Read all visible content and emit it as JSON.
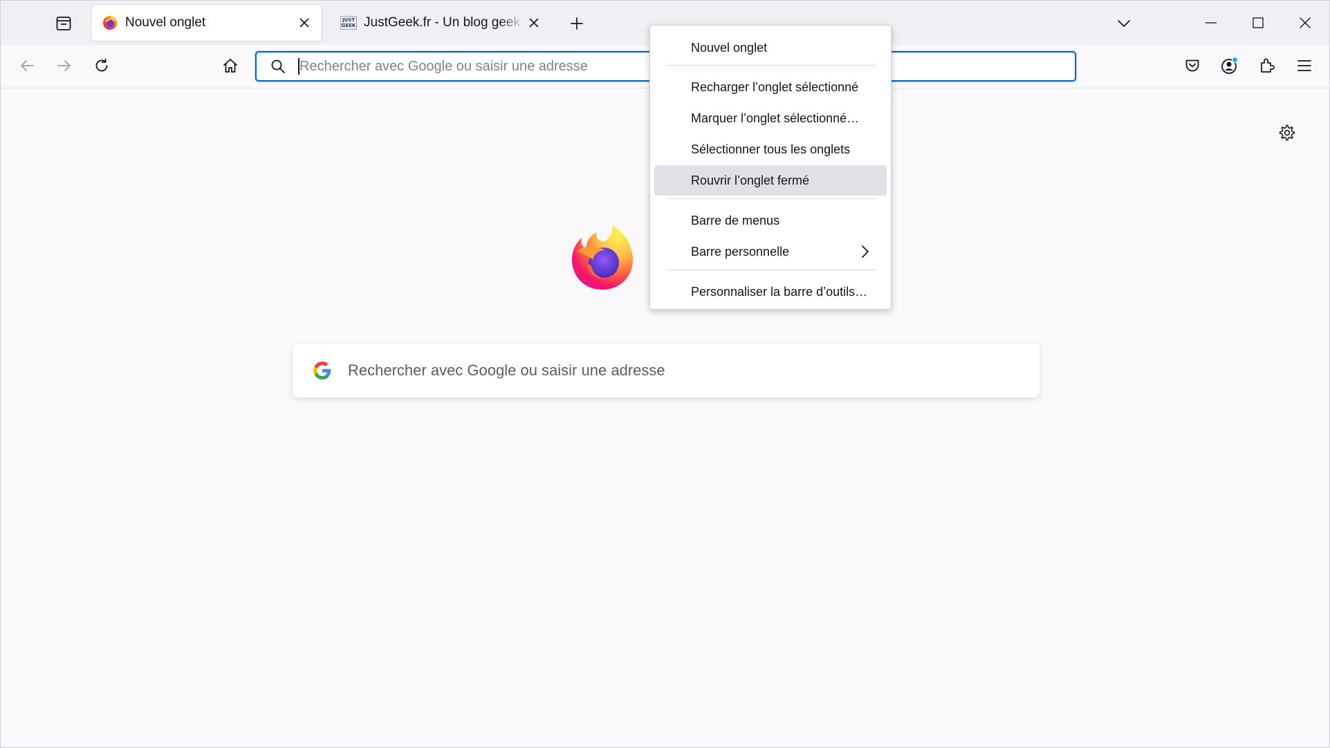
{
  "tabs": [
    {
      "title": "Nouvel onglet",
      "selected": true
    },
    {
      "title": "JustGeek.fr - Un blog geek et high-tech",
      "selected": false
    }
  ],
  "favicon_text": "JUST GEEK",
  "urlbar": {
    "placeholder": "Rechercher avec Google ou saisir une adresse"
  },
  "newtab": {
    "search_placeholder": "Rechercher avec Google ou saisir une adresse"
  },
  "context_menu": {
    "items": [
      {
        "label": "Nouvel onglet"
      },
      {
        "label": "Recharger l’onglet sélectionné"
      },
      {
        "label": "Marquer l’onglet sélectionné…"
      },
      {
        "label": "Sélectionner tous les onglets"
      },
      {
        "label": "Rouvrir l’onglet fermé",
        "hovered": true
      },
      {
        "label": "Barre de menus"
      },
      {
        "label": "Barre personnelle",
        "has_submenu": true
      },
      {
        "label": "Personnaliser la barre d’outils…"
      }
    ]
  },
  "icons": {
    "tab_list": "firefox-view-icon",
    "back": "back-arrow-icon",
    "forward": "forward-arrow-icon",
    "reload": "reload-icon",
    "home": "home-icon",
    "pocket": "pocket-icon",
    "account": "account-icon",
    "extensions": "extensions-icon",
    "menu": "hamburger-menu-icon",
    "settings": "gear-icon"
  },
  "colors": {
    "accent": "#0061e0",
    "tabstrip_bg": "#f0f0f4",
    "page_bg": "#f9f9fb",
    "menu_hover": "#e0e0e6",
    "account_badge": "#00b3f4"
  }
}
